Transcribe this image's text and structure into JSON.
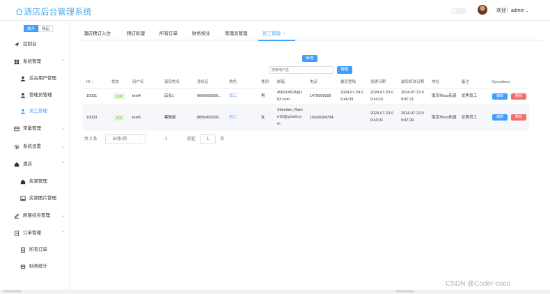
{
  "header": {
    "app_title": "酒店后台管理系统",
    "user_greeting": "欢迎：admin",
    "colors": {
      "brand": "#4aa8e6",
      "primary": "#409eff",
      "danger": "#f56c6c",
      "success": "#67c23a"
    }
  },
  "sidebar": {
    "expand_label": "展开",
    "collapse_label": "收起",
    "items": [
      {
        "label": "控制台",
        "icon": "paper-plane-icon"
      },
      {
        "label": "系统管理",
        "icon": "grid-icon"
      },
      {
        "label": "后台用户管理",
        "icon": "user-icon"
      },
      {
        "label": "管理员管理",
        "icon": "user-icon"
      },
      {
        "label": "员工管理",
        "icon": "user-icon"
      },
      {
        "label": "常量管理",
        "icon": "table-icon"
      },
      {
        "label": "系统设置",
        "icon": "gear-icon"
      },
      {
        "label": "酒店",
        "icon": "house-icon"
      },
      {
        "label": "房源管理",
        "icon": "house-icon"
      },
      {
        "label": "房源图片管理",
        "icon": "image-icon"
      },
      {
        "label": "顾客综合管理",
        "icon": "edit-icon"
      },
      {
        "label": "订单管理",
        "icon": "document-icon"
      },
      {
        "label": "所有订单",
        "icon": "document-icon"
      },
      {
        "label": "财务统计",
        "icon": "coins-icon"
      }
    ]
  },
  "tabs": [
    {
      "label": "酒店预订入住"
    },
    {
      "label": "预订处理"
    },
    {
      "label": "所有订单"
    },
    {
      "label": "财务统计"
    },
    {
      "label": "管理员管理"
    },
    {
      "label": "员工管理"
    }
  ],
  "toolbar": {
    "add_label": "新增",
    "search_placeholder": "搜索用户名",
    "search_label": "搜索"
  },
  "table": {
    "headers": [
      "ID",
      "状态",
      "用户名",
      "真实姓名",
      "身份证",
      "角色",
      "性别",
      "邮箱",
      "电话",
      "最后登陆",
      "创建日期",
      "最后修改日期",
      "地址",
      "备注",
      "Operations"
    ],
    "rows": [
      {
        "id": "10031",
        "status": "启用",
        "username": "test4",
        "realname": "店长1",
        "idcard": "6666666666...",
        "role": "员工",
        "gender": "男",
        "email_1": "456914518@1",
        "email_2": "63.com",
        "phone": "1478999099",
        "last_login_1": "2024-07-24 0",
        "last_login_2": "9:46:39",
        "created_1": "2024-07-23 0",
        "created_2": "9:43:15",
        "modified_1": "2024-07-23 0",
        "modified_2": "9:47:21",
        "address": "南京市xxx街道",
        "remark": "优秀员工",
        "edit": "编辑",
        "delete": "删除"
      },
      {
        "id": "10033",
        "status": "启用",
        "username": "test6",
        "realname": "蔡聪颖",
        "idcard": "8856452009...",
        "role": "员工",
        "gender": "女",
        "email_1": "Shendan_Ratn",
        "email_2": "e15@gmail.co",
        "email_3": "m",
        "phone": "15636084794",
        "last_login_1": "",
        "last_login_2": "",
        "created_1": "2024-07-23 0",
        "created_2": "9:43:31",
        "modified_1": "2024-07-23 0",
        "modified_2": "9:47:29",
        "address": "南京市xxx街道",
        "remark": "优秀员工",
        "edit": "编辑",
        "delete": "删除"
      }
    ]
  },
  "pagination": {
    "total": "共 2 条",
    "page_size": "50条/页",
    "current_page": "1",
    "goto_label": "前往",
    "goto_value": "1",
    "page_suffix": "页"
  },
  "watermark": "CSDN @Coder-coco"
}
